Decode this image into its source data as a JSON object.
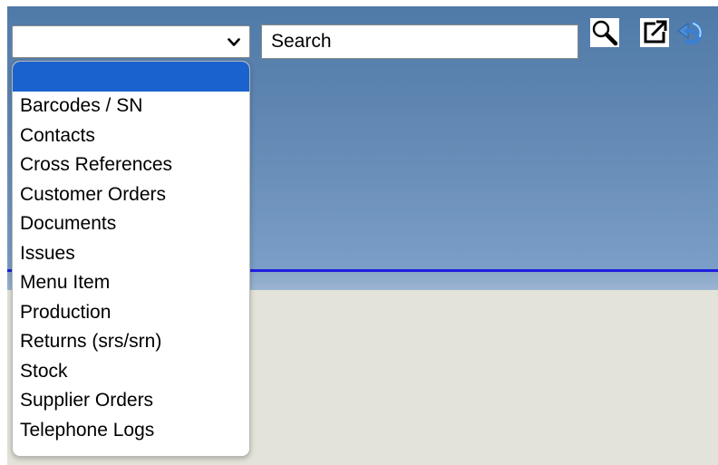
{
  "toolbar": {
    "module_select": {
      "value": "",
      "options": [
        "",
        "Barcodes / SN",
        "Contacts",
        "Cross References",
        "Customer Orders",
        "Documents",
        "Issues",
        "Menu Item",
        "Production",
        "Returns (srs/srn)",
        "Stock",
        "Supplier Orders",
        "Telephone Logs"
      ]
    },
    "search": {
      "value": "Search",
      "placeholder": "Search"
    },
    "icons": [
      "search-icon",
      "open-external-icon",
      "refresh-icon"
    ]
  },
  "colors": {
    "header_top": "#4f7aa8",
    "header_bottom": "#7a9ec7",
    "rule": "#1f1fe0",
    "content_bg": "#e4e3da",
    "selection": "#1a63cf"
  }
}
